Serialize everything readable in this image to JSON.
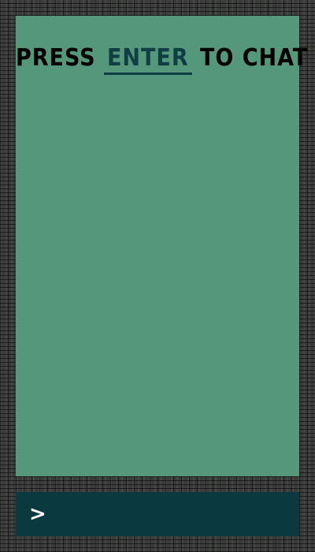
{
  "chat": {
    "title_prefix": "PRESS",
    "title_key": "ENTER",
    "title_suffix": "TO CHAT",
    "messages": []
  },
  "input": {
    "prompt_symbol": ">",
    "value": ""
  },
  "colors": {
    "chat_background": "#55977a",
    "input_background": "#0a3a40",
    "key_highlight": "#0e3f43",
    "frame": "#3a3c3a"
  }
}
